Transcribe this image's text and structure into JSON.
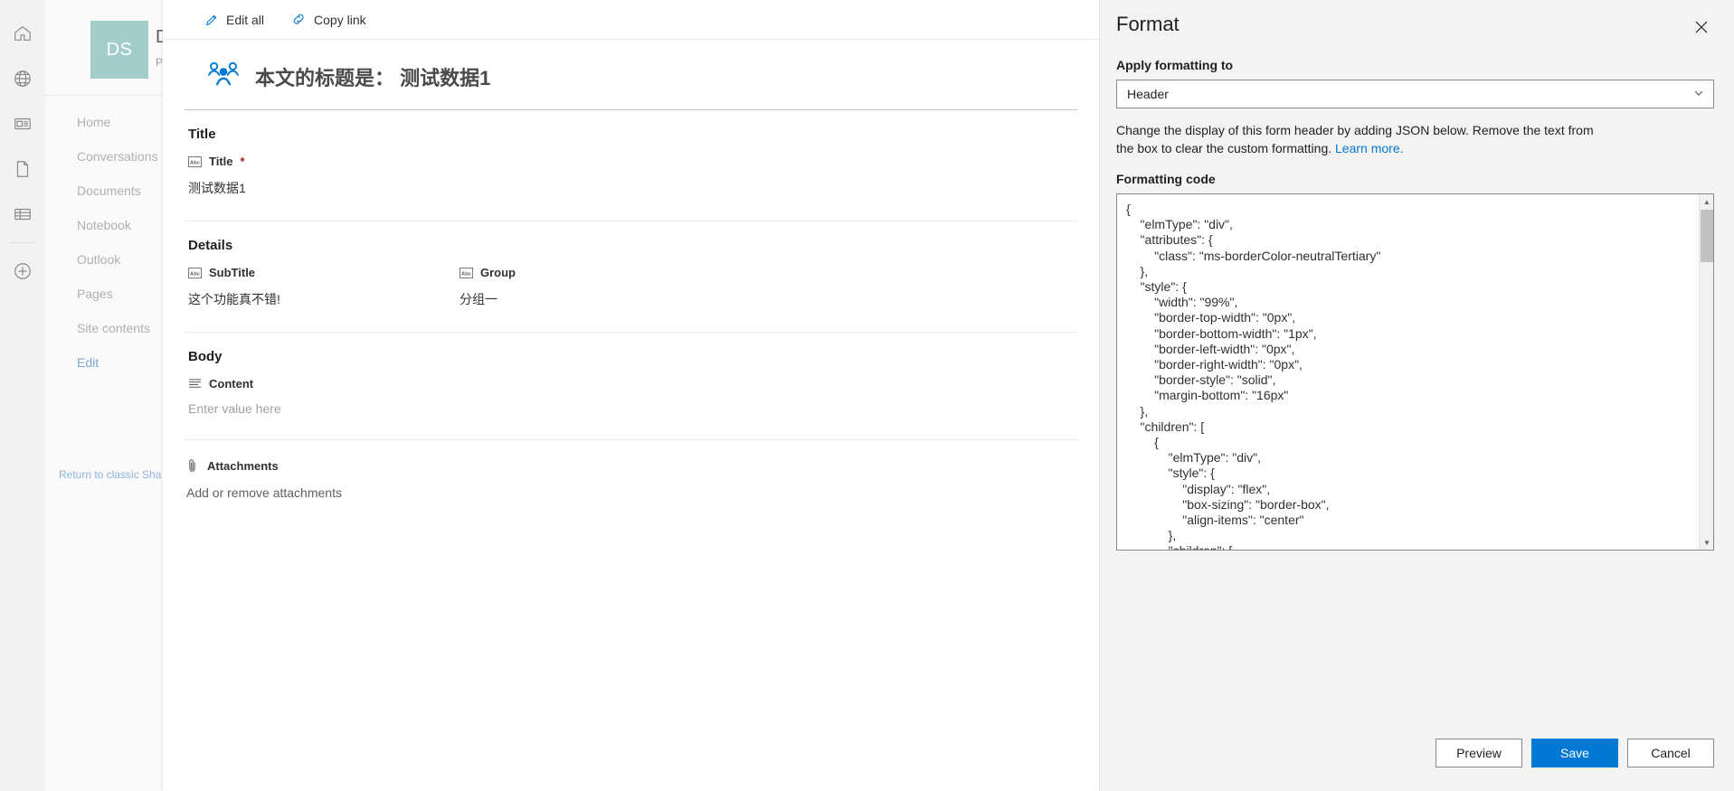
{
  "rail": {
    "items": [
      {
        "name": "home-icon",
        "label": "Home"
      },
      {
        "name": "globe-icon",
        "label": "My sites"
      },
      {
        "name": "news-icon",
        "label": "News"
      },
      {
        "name": "page-icon",
        "label": "Pages"
      },
      {
        "name": "list-icon",
        "label": "Lists"
      },
      {
        "name": "create-icon",
        "label": "Create"
      }
    ]
  },
  "site": {
    "logo_initials": "DS",
    "title": "D",
    "subtitle": "P",
    "nav": [
      {
        "label": "Home"
      },
      {
        "label": "Conversations"
      },
      {
        "label": "Documents"
      },
      {
        "label": "Notebook"
      },
      {
        "label": "Outlook"
      },
      {
        "label": "Pages"
      },
      {
        "label": "Site contents"
      },
      {
        "label": "Edit"
      }
    ],
    "return_link": "Return to classic Sha"
  },
  "commandbar": {
    "edit_all": "Edit all",
    "copy_link": "Copy link"
  },
  "form": {
    "header_text": "本文的标题是： 测试数据1",
    "sections": [
      {
        "title": "Title",
        "fields": [
          {
            "label": "Title",
            "required": true,
            "icon": "abc-icon",
            "value": "测试数据1",
            "is_placeholder": false
          }
        ]
      },
      {
        "title": "Details",
        "fields": [
          {
            "label": "SubTitle",
            "required": false,
            "icon": "abc-icon",
            "value": "这个功能真不错!",
            "is_placeholder": false
          },
          {
            "label": "Group",
            "required": false,
            "icon": "abc-icon",
            "value": "分组一",
            "is_placeholder": false
          }
        ]
      },
      {
        "title": "Body",
        "fields": [
          {
            "label": "Content",
            "required": false,
            "icon": "multiline-icon",
            "value": "Enter value here",
            "is_placeholder": true
          }
        ]
      }
    ],
    "attachments": {
      "label": "Attachments",
      "icon": "paperclip-icon",
      "value": "Add or remove attachments"
    }
  },
  "panel": {
    "title": "Format",
    "close_label": "Close",
    "apply_to_label": "Apply formatting to",
    "apply_to_value": "Header",
    "description_prefix": "Change the display of this form header by adding JSON below. Remove the text from the box to clear the custom formatting. ",
    "learn_more": "Learn more.",
    "code_label": "Formatting code",
    "code_value": "{\n    \"elmType\": \"div\",\n    \"attributes\": {\n        \"class\": \"ms-borderColor-neutralTertiary\"\n    },\n    \"style\": {\n        \"width\": \"99%\",\n        \"border-top-width\": \"0px\",\n        \"border-bottom-width\": \"1px\",\n        \"border-left-width\": \"0px\",\n        \"border-right-width\": \"0px\",\n        \"border-style\": \"solid\",\n        \"margin-bottom\": \"16px\"\n    },\n    \"children\": [\n        {\n            \"elmType\": \"div\",\n            \"style\": {\n                \"display\": \"flex\",\n                \"box-sizing\": \"border-box\",\n                \"align-items\": \"center\"\n            },\n            \"children\": [",
    "buttons": {
      "preview": "Preview",
      "save": "Save",
      "cancel": "Cancel"
    }
  },
  "colors": {
    "accent": "#0078d4",
    "logo_bg": "#a3cdcd",
    "required_red": "#a4262c",
    "panel_bg": "#f4f3f2"
  }
}
